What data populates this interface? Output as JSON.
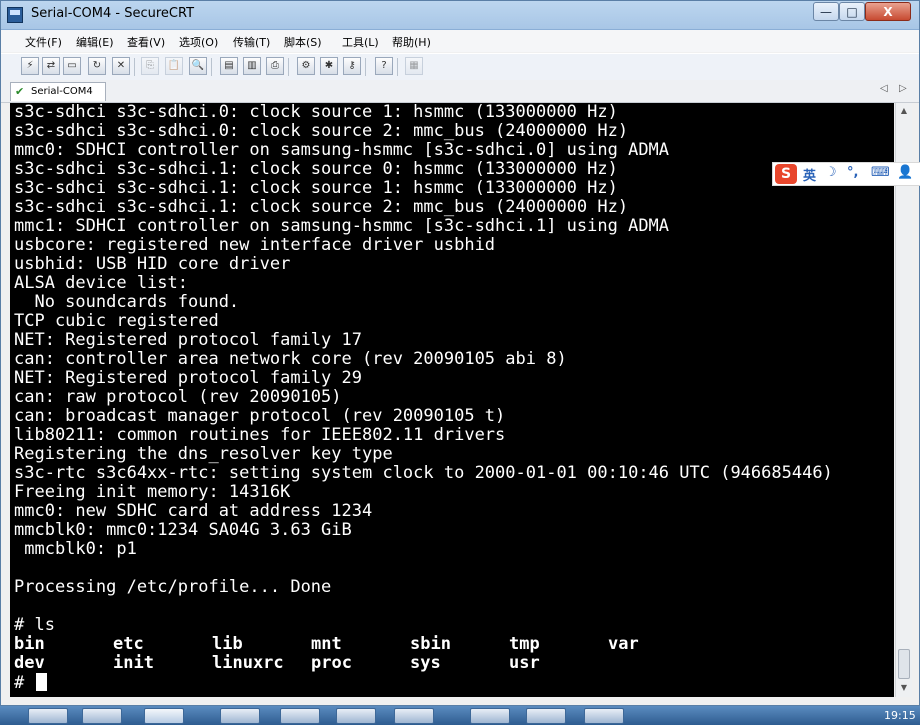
{
  "window": {
    "title": "Serial-COM4 - SecureCRT"
  },
  "titlebar_buttons": {
    "minimize": "—",
    "maximize": "□",
    "close": "X"
  },
  "menu": [
    "文件(F)",
    "编辑(E)",
    "查看(V)",
    "选项(O)",
    "传输(T)",
    "脚本(S)",
    "工具(L)",
    "帮助(H)"
  ],
  "tab": {
    "label": "Serial-COM4",
    "status_icon": "check-icon"
  },
  "terminal": {
    "lines": [
      "s3c-sdhci s3c-sdhci.0: clock source 1: hsmmc (133000000 Hz)",
      "s3c-sdhci s3c-sdhci.0: clock source 2: mmc_bus (24000000 Hz)",
      "mmc0: SDHCI controller on samsung-hsmmc [s3c-sdhci.0] using ADMA",
      "s3c-sdhci s3c-sdhci.1: clock source 0: hsmmc (133000000 Hz)",
      "s3c-sdhci s3c-sdhci.1: clock source 1: hsmmc (133000000 Hz)",
      "s3c-sdhci s3c-sdhci.1: clock source 2: mmc_bus (24000000 Hz)",
      "mmc1: SDHCI controller on samsung-hsmmc [s3c-sdhci.1] using ADMA",
      "usbcore: registered new interface driver usbhid",
      "usbhid: USB HID core driver",
      "ALSA device list:",
      "  No soundcards found.",
      "TCP cubic registered",
      "NET: Registered protocol family 17",
      "can: controller area network core (rev 20090105 abi 8)",
      "NET: Registered protocol family 29",
      "can: raw protocol (rev 20090105)",
      "can: broadcast manager protocol (rev 20090105 t)",
      "lib80211: common routines for IEEE802.11 drivers",
      "Registering the dns_resolver key type",
      "s3c-rtc s3c64xx-rtc: setting system clock to 2000-01-01 00:10:46 UTC (946685446)",
      "Freeing init memory: 14316K",
      "mmc0: new SDHC card at address 1234",
      "mmcblk0: mmc0:1234 SA04G 3.63 GiB",
      " mmcblk0: p1",
      "",
      "Processing /etc/profile... Done",
      "",
      "# ls"
    ],
    "ls_rows": [
      [
        "bin",
        "etc",
        "lib",
        "mnt",
        "sbin",
        "tmp",
        "var"
      ],
      [
        "dev",
        "init",
        "linuxrc",
        "proc",
        "sys",
        "usr"
      ]
    ],
    "prompt": "# "
  },
  "ime": {
    "logo": "S",
    "mode": "英",
    "moon": "☽",
    "punct": "°,",
    "keyboard": "⌨",
    "extra": "👤"
  },
  "taskbar": {
    "time": "19:15"
  }
}
